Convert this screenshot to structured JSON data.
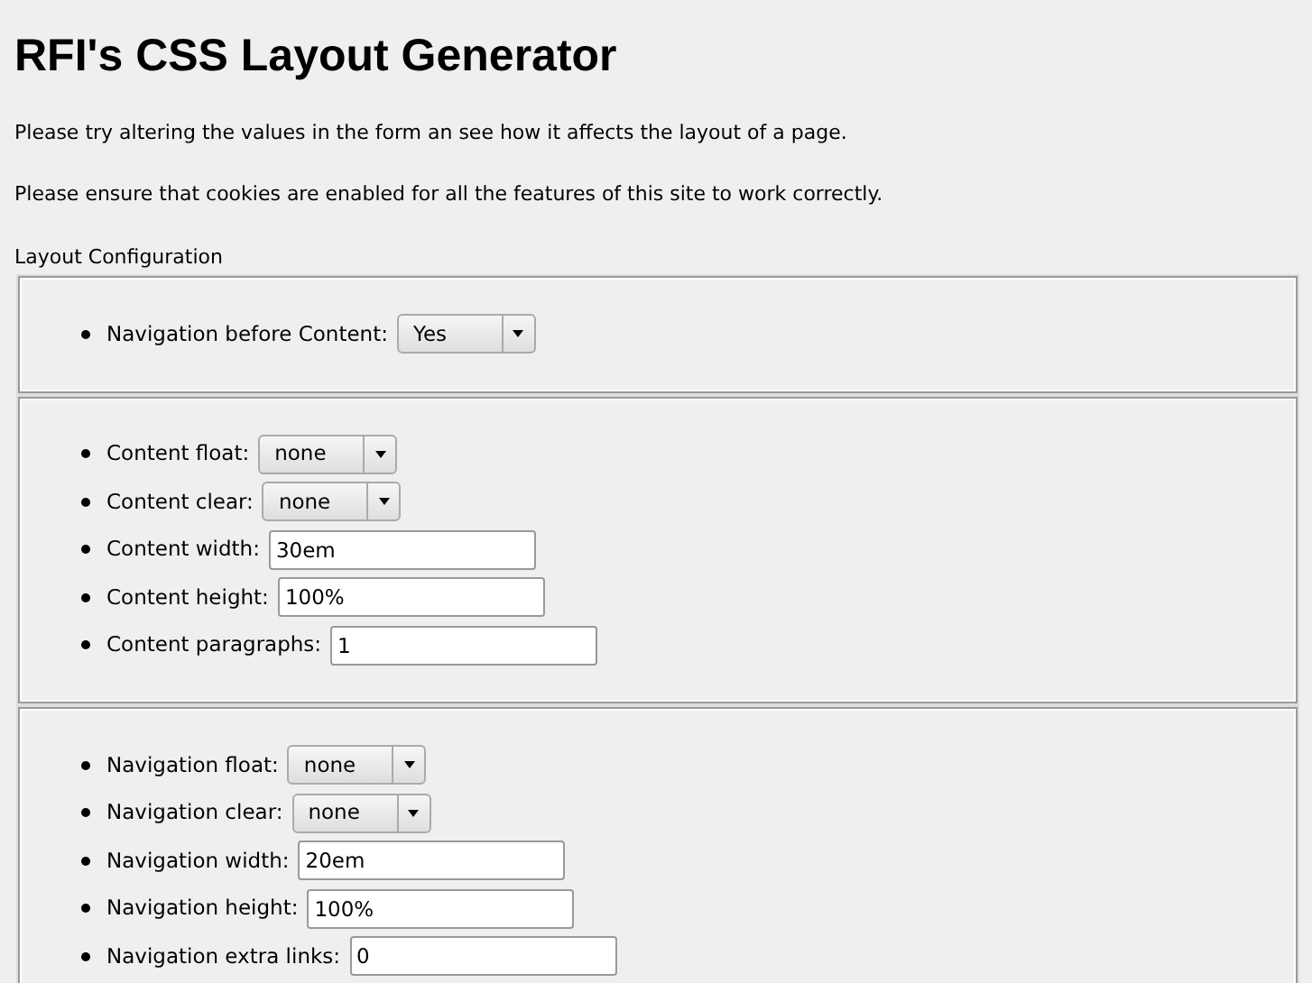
{
  "title": "RFI's CSS Layout Generator",
  "paragraphs": [
    "Please try altering the values in the form an see how it affects the layout of a page.",
    "Please ensure that cookies are enabled for all the features of this site to work correctly."
  ],
  "form": {
    "legend": "Layout Configuration",
    "fieldsets": [
      {
        "items": [
          {
            "kind": "select",
            "label": "Navigation before Content:",
            "value": "Yes"
          }
        ]
      },
      {
        "items": [
          {
            "kind": "select",
            "label": "Content float:",
            "value": "none"
          },
          {
            "kind": "select",
            "label": "Content clear:",
            "value": "none"
          },
          {
            "kind": "text",
            "label": "Content width:",
            "value": "30em"
          },
          {
            "kind": "text",
            "label": "Content height:",
            "value": "100%"
          },
          {
            "kind": "text",
            "label": "Content paragraphs:",
            "value": "1"
          }
        ]
      },
      {
        "items": [
          {
            "kind": "select",
            "label": "Navigation float:",
            "value": "none"
          },
          {
            "kind": "select",
            "label": "Navigation clear:",
            "value": "none"
          },
          {
            "kind": "text",
            "label": "Navigation width:",
            "value": "20em"
          },
          {
            "kind": "text",
            "label": "Navigation height:",
            "value": "100%"
          },
          {
            "kind": "text",
            "label": "Navigation extra links:",
            "value": "0"
          }
        ]
      }
    ]
  }
}
